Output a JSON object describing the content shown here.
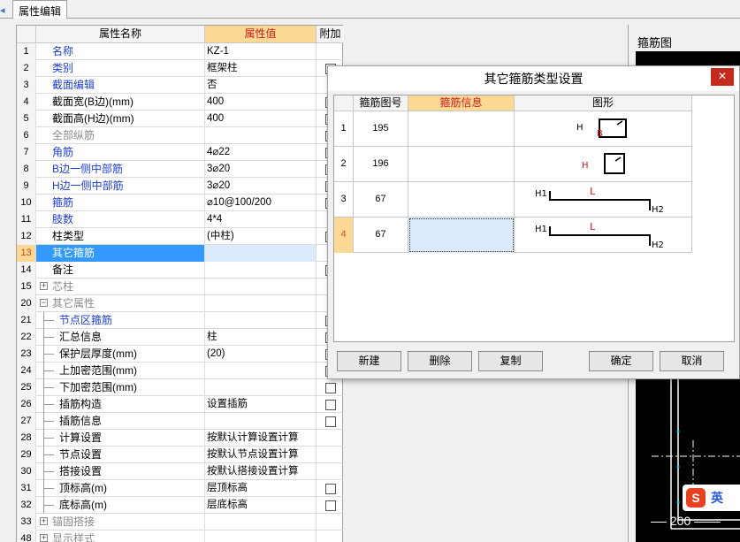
{
  "tab": {
    "label": "属性编辑"
  },
  "grid": {
    "headers": {
      "num": "",
      "name": "属性名称",
      "value": "属性值",
      "extra": "附加"
    },
    "rows": [
      {
        "num": "1",
        "name": "名称",
        "value": "KZ-1",
        "style": "blue",
        "cb": false
      },
      {
        "num": "2",
        "name": "类别",
        "value": "框架柱",
        "style": "blue",
        "cb": true
      },
      {
        "num": "3",
        "name": "截面编辑",
        "value": "否",
        "style": "blue",
        "cb": false
      },
      {
        "num": "4",
        "name": "截面宽(B边)(mm)",
        "value": "400",
        "style": "",
        "cb": true
      },
      {
        "num": "5",
        "name": "截面高(H边)(mm)",
        "value": "400",
        "style": "",
        "cb": true
      },
      {
        "num": "6",
        "name": "全部纵筋",
        "value": "",
        "style": "gray",
        "cb": true
      },
      {
        "num": "7",
        "name": "角筋",
        "value": "4⌀22",
        "style": "blue",
        "cb": true
      },
      {
        "num": "8",
        "name": "B边一侧中部筋",
        "value": "3⌀20",
        "style": "blue",
        "cb": true
      },
      {
        "num": "9",
        "name": "H边一侧中部筋",
        "value": "3⌀20",
        "style": "blue",
        "cb": true
      },
      {
        "num": "10",
        "name": "箍筋",
        "value": "⌀10@100/200",
        "style": "blue",
        "cb": true
      },
      {
        "num": "11",
        "name": "肢数",
        "value": "4*4",
        "style": "blue",
        "cb": false
      },
      {
        "num": "12",
        "name": "柱类型",
        "value": "(中柱)",
        "style": "",
        "cb": true
      },
      {
        "num": "13",
        "name": "其它箍筋",
        "value": "",
        "style": "sel",
        "cb": false
      },
      {
        "num": "14",
        "name": "备注",
        "value": "",
        "style": "",
        "cb": true
      },
      {
        "num": "15",
        "name": "芯柱",
        "value": "",
        "style": "gray",
        "tree": "+",
        "cb": false
      },
      {
        "num": "20",
        "name": "其它属性",
        "value": "",
        "style": "gray",
        "tree": "−",
        "cb": false
      },
      {
        "num": "21",
        "name": "节点区箍筋",
        "value": "",
        "style": "blue",
        "child": true,
        "cb": true
      },
      {
        "num": "22",
        "name": "汇总信息",
        "value": "柱",
        "style": "",
        "child": true,
        "cb": true
      },
      {
        "num": "23",
        "name": "保护层厚度(mm)",
        "value": "(20)",
        "style": "",
        "child": true,
        "cb": true
      },
      {
        "num": "24",
        "name": "上加密范围(mm)",
        "value": "",
        "style": "",
        "child": true,
        "cb": true
      },
      {
        "num": "25",
        "name": "下加密范围(mm)",
        "value": "",
        "style": "",
        "child": true,
        "cb": true
      },
      {
        "num": "26",
        "name": "插筋构造",
        "value": "设置插筋",
        "style": "",
        "child": true,
        "cb": true
      },
      {
        "num": "27",
        "name": "插筋信息",
        "value": "",
        "style": "",
        "child": true,
        "cb": true
      },
      {
        "num": "28",
        "name": "计算设置",
        "value": "按默认计算设置计算",
        "style": "",
        "child": true,
        "cb": false
      },
      {
        "num": "29",
        "name": "节点设置",
        "value": "按默认节点设置计算",
        "style": "",
        "child": true,
        "cb": false
      },
      {
        "num": "30",
        "name": "搭接设置",
        "value": "按默认搭接设置计算",
        "style": "",
        "child": true,
        "cb": false
      },
      {
        "num": "31",
        "name": "顶标高(m)",
        "value": "层顶标高",
        "style": "",
        "child": true,
        "cb": true
      },
      {
        "num": "32",
        "name": "底标高(m)",
        "value": "层底标高",
        "style": "",
        "child": true,
        "cb": true
      },
      {
        "num": "33",
        "name": "锚固搭接",
        "value": "",
        "style": "gray",
        "tree": "+",
        "cb": false
      },
      {
        "num": "48",
        "name": "显示样式",
        "value": "",
        "style": "gray",
        "tree": "+",
        "cb": false
      }
    ]
  },
  "right_panel": {
    "title": "箍筋图",
    "dimension": "200"
  },
  "dialog": {
    "title": "其它箍筋类型设置",
    "close": "✕",
    "headers": {
      "num": "",
      "code": "箍筋图号",
      "info": "箍筋信息",
      "shape": "图形"
    },
    "rows": [
      {
        "num": "1",
        "code": "195",
        "info": "",
        "shape": "hoop-b"
      },
      {
        "num": "2",
        "code": "196",
        "info": "",
        "shape": "hoop-h"
      },
      {
        "num": "3",
        "code": "67",
        "info": "",
        "shape": "bar-l"
      },
      {
        "num": "4",
        "code": "67",
        "info": "",
        "shape": "bar-l"
      }
    ],
    "buttons": {
      "new": "新建",
      "delete": "删除",
      "copy": "复制",
      "ok": "确定",
      "cancel": "取消"
    }
  },
  "shape_labels": {
    "H": "H",
    "B": "B",
    "L": "L",
    "H1": "H1",
    "H2": "H2"
  },
  "ime": {
    "logo": "S",
    "text": "英"
  },
  "colors": {
    "accent_blue": "#1f3fcf",
    "selected_blue": "#3399ff",
    "header_orange": "#fcd895",
    "header_red_text": "#c81e1e"
  }
}
